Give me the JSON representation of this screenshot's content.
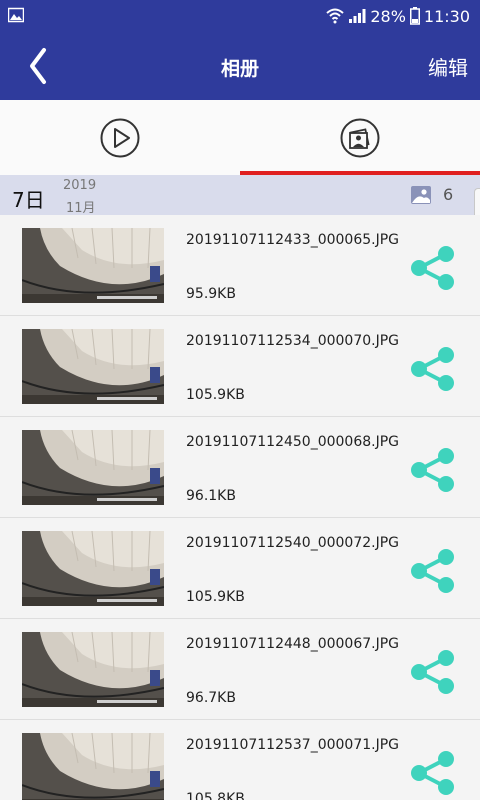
{
  "status_bar": {
    "battery": "28%",
    "time": "11:30",
    "icons": [
      "gallery-icon",
      "wifi-icon",
      "signal-icon",
      "battery-icon"
    ]
  },
  "app_bar": {
    "back_icon": "chevron-left-icon",
    "title": "相册",
    "edit_label": "编辑"
  },
  "tabs": [
    {
      "icon": "play-circle-icon",
      "active": false
    },
    {
      "icon": "photo-album-icon",
      "active": true
    }
  ],
  "colors": {
    "primary": "#2f3b9c",
    "tab_indicator": "#e02020",
    "share": "#3fd3bd",
    "date_header_bg": "#d9dcec"
  },
  "date_group": {
    "day": "7日",
    "year": "2019",
    "month": "11月",
    "count": "6",
    "count_icon": "image-icon"
  },
  "files": [
    {
      "name": "20191107112433_000065.JPG",
      "size": "95.9KB"
    },
    {
      "name": "20191107112534_000070.JPG",
      "size": "105.9KB"
    },
    {
      "name": "20191107112450_000068.JPG",
      "size": "96.1KB"
    },
    {
      "name": "20191107112540_000072.JPG",
      "size": "105.9KB"
    },
    {
      "name": "20191107112448_000067.JPG",
      "size": "96.7KB"
    },
    {
      "name": "20191107112537_000071.JPG",
      "size": "105.8KB"
    }
  ]
}
